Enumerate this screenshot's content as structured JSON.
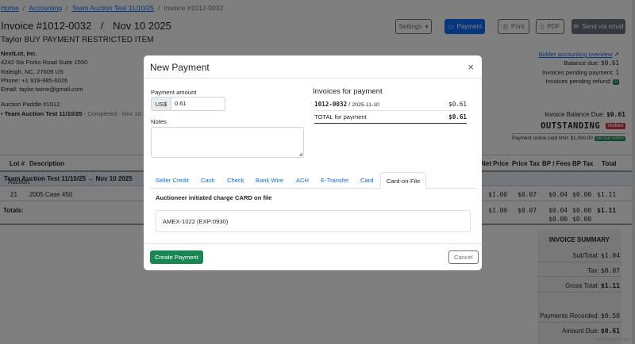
{
  "breadcrumb": {
    "home": "Home",
    "accounting": "Accounting",
    "auction": "Team Auction Test 11/10/25",
    "current": "Invoice #1012-0032",
    "sep": "/"
  },
  "invoice": {
    "number": "Invoice #1012-0032",
    "slash": "/",
    "date": "Nov 10 2025",
    "subtitle": "Taylor BUY PAYMENT RESTRICTED ITEM"
  },
  "address": {
    "company": "NextLot, Inc.",
    "street": "4242 Six Forks Road Suite 1550",
    "city": "Raleigh, NC, 27609 US",
    "phone": "Phone: +1 919-985-6026",
    "email": "Email: taylor.twine@gmail.com"
  },
  "paddle": {
    "label": "Auction Paddle #1012",
    "bullet": "•",
    "auction": "Team Auction Test 11/10/25",
    "status": "- Completed - Nov 10 2"
  },
  "toolbar": {
    "settings": "Settings",
    "payment": "Payment",
    "print": "Print",
    "pdf": "PDF",
    "email": "Send via email"
  },
  "account": {
    "overview": "Bidder accounting overview",
    "balance_due_label": "Balance due:",
    "balance_due": "$0.61",
    "pending_payment_label": "Invoices pending payment:",
    "pending_payment": "1",
    "pending_refund_label": "Invoices pending refund:",
    "pending_refund": "0"
  },
  "balance": {
    "label": "Invoice Balance Due:",
    "value": "$0.61",
    "status": "OUTSTANDING",
    "locked": "locked",
    "card_limit": "Payment online card limit: $1,000.00",
    "can_pay": "can pay online"
  },
  "table": {
    "headers": [
      "Lot #",
      "Description",
      "Net Price",
      "Price Tax",
      "BP / Fees",
      "BP Tax",
      "Total"
    ],
    "auction_prefix": "Auction: ",
    "auction_row": "Team Auction Test 11/10/25 → Nov 10 2025",
    "row": {
      "lot": "21",
      "desc": "2005 Case 450",
      "net": "$1.00",
      "ptax": "$0.07",
      "bp": "$0.04",
      "bptax": "$0.00",
      "total": "$1.11"
    },
    "totals_label": "Totals:",
    "totals": {
      "net": "$1.00",
      "ptax": "$0.07",
      "bp1": "$0.04",
      "bp2": "$0.00",
      "bptax1": "$0.00",
      "bptax2": "$0.00",
      "total": "$1.11"
    }
  },
  "summary": {
    "title": "INVOICE SUMMARY",
    "subtotal_label": "SubTotal:",
    "subtotal": "$1.04",
    "tax_label": "Tax:",
    "tax": "$0.07",
    "gross_label": "Gross Total:",
    "gross": "$1.11",
    "recorded_label": "Payments Recorded:",
    "recorded": "$0.50",
    "due_label": "Amount Due:",
    "due": "$0.61"
  },
  "modal": {
    "title": "New Payment",
    "close": "×",
    "amount_label": "Payment amount",
    "currency": "US$",
    "amount": "0.61",
    "notes_label": "Notes",
    "invoices_label": "Invoices for payment",
    "invoice_no": "1012-0032",
    "invoice_sep": "/",
    "invoice_date": "2025-11-10",
    "invoice_amt": "$0.61",
    "total_label": "TOTAL for payment",
    "total_amt": "$0.61",
    "tabs": [
      "Seller Credit",
      "Cash",
      "Check",
      "Bank Wire",
      "ACH",
      "E-Transfer",
      "Card",
      "Card-on-File"
    ],
    "card_heading": "Auctioneer initiated charge CARD on file",
    "card_value": "AMEX-1022 (EXP:0930)",
    "create": "Create Payment",
    "cancel": "Cancel"
  },
  "stamp": "#9bb402 (pd=1004)"
}
